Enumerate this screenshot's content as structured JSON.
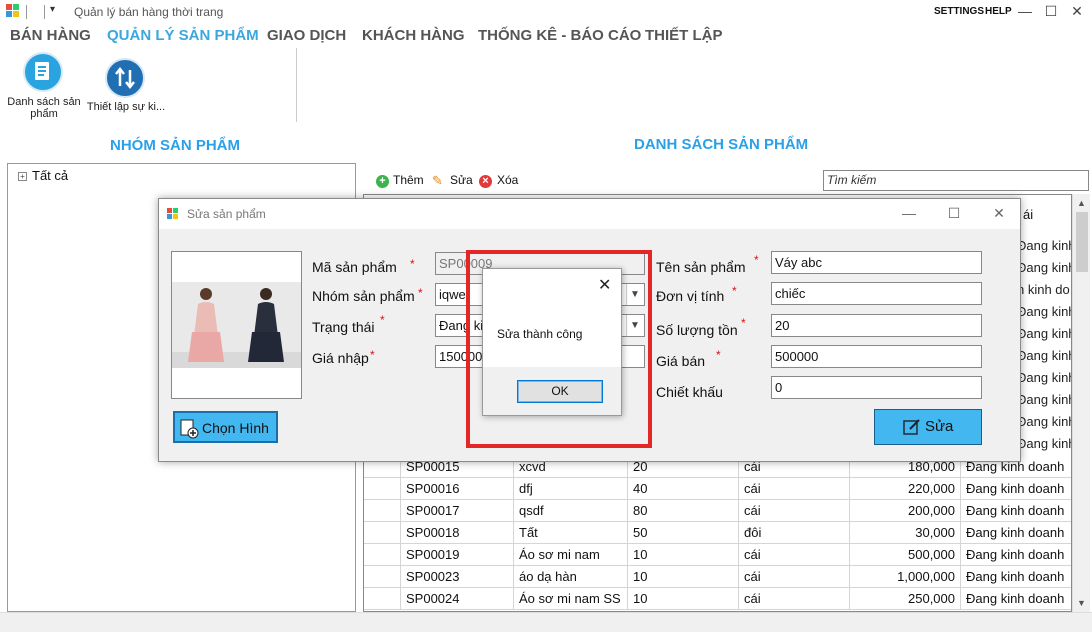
{
  "window": {
    "title": "Quản lý bán hàng thời trang",
    "settings_label": "SETTINGS",
    "help_label": "HELP",
    "minimize": "—",
    "maximize": "☐",
    "close": "✕"
  },
  "menu": {
    "tabs": [
      {
        "label": "BÁN HÀNG",
        "active": false
      },
      {
        "label": "QUẢN LÝ SẢN PHẨM",
        "active": true
      },
      {
        "label": "GIAO DỊCH",
        "active": false
      },
      {
        "label": "KHÁCH HÀNG",
        "active": false
      },
      {
        "label": "THỐNG KÊ - BÁO CÁO",
        "active": false
      },
      {
        "label": "THIẾT LẬP",
        "active": false
      }
    ]
  },
  "ribbon": {
    "buttons": [
      {
        "label_line1": "Danh sách sản",
        "label_line2": "phẩm",
        "icon": "product-list-icon"
      },
      {
        "label_line1": "Thiết lập sự ki...",
        "label_line2": "",
        "icon": "event-setup-icon"
      }
    ]
  },
  "left_panel": {
    "title": "NHÓM SẢN PHẨM",
    "tree_root": "Tất cả"
  },
  "right_panel": {
    "title": "DANH SÁCH SẢN PHẨM",
    "toolbar": {
      "add": "Thêm",
      "edit": "Sửa",
      "delete": "Xóa"
    },
    "search_placeholder": "Tìm kiếm",
    "header_fragment": "ái",
    "partial_status_rows": [
      "Đang kinh doanh",
      "Đang kinh doanh",
      "n kinh do...",
      "Đang kinh doanh",
      "Đang kinh doanh",
      "Đang kinh doanh",
      "Đang kinh doanh",
      "Đang kinh doanh",
      "Đang kinh doanh",
      "Đang kinh doanh"
    ],
    "rows": [
      {
        "code": "SP00015",
        "name": "xcvd",
        "qty": "20",
        "unit": "cái",
        "price": "180,000",
        "status": "Đang kinh doanh"
      },
      {
        "code": "SP00016",
        "name": "dfj",
        "qty": "40",
        "unit": "cái",
        "price": "220,000",
        "status": "Đang kinh doanh"
      },
      {
        "code": "SP00017",
        "name": "qsdf",
        "qty": "80",
        "unit": "cái",
        "price": "200,000",
        "status": "Đang kinh doanh"
      },
      {
        "code": "SP00018",
        "name": "Tất",
        "qty": "50",
        "unit": "đôi",
        "price": "30,000",
        "status": "Đang kinh doanh"
      },
      {
        "code": "SP00019",
        "name": "Áo sơ mi nam",
        "qty": "10",
        "unit": "cái",
        "price": "500,000",
        "status": "Đang kinh doanh"
      },
      {
        "code": "SP00023",
        "name": "áo dạ hàn",
        "qty": "10",
        "unit": "cái",
        "price": "1,000,000",
        "status": "Đang kinh doanh"
      },
      {
        "code": "SP00024",
        "name": "Áo sơ mi nam SS",
        "qty": "10",
        "unit": "cái",
        "price": "250,000",
        "status": "Đang kinh doanh"
      }
    ]
  },
  "edit_dialog": {
    "title": "Sửa sản phẩm",
    "choose_image": "Chọn Hình",
    "save": "Sửa",
    "labels": {
      "code": "Mã sản phẩm",
      "group": "Nhóm sản phẩm",
      "status": "Trạng thái",
      "import_price": "Giá nhập",
      "name": "Tên sản phẩm",
      "unit": "Đơn vị tính",
      "stock": "Số lượng tồn",
      "sale_price": "Giá bán",
      "discount": "Chiết khấu"
    },
    "values": {
      "code": "SP00009",
      "group": "iqwe",
      "status": "Đang ki",
      "import_price": "150000",
      "name": "Váy abc",
      "unit": "chiếc",
      "stock": "20",
      "sale_price": "500000",
      "discount": "0"
    },
    "required_mark": "*"
  },
  "message_box": {
    "text": "Sửa thành công",
    "ok": "OK",
    "close": "✕"
  },
  "colors": {
    "accent": "#3aa7e0",
    "button_blue": "#43b8f0",
    "highlight_red": "#e32727",
    "arrow_green": "#4aba3f"
  }
}
